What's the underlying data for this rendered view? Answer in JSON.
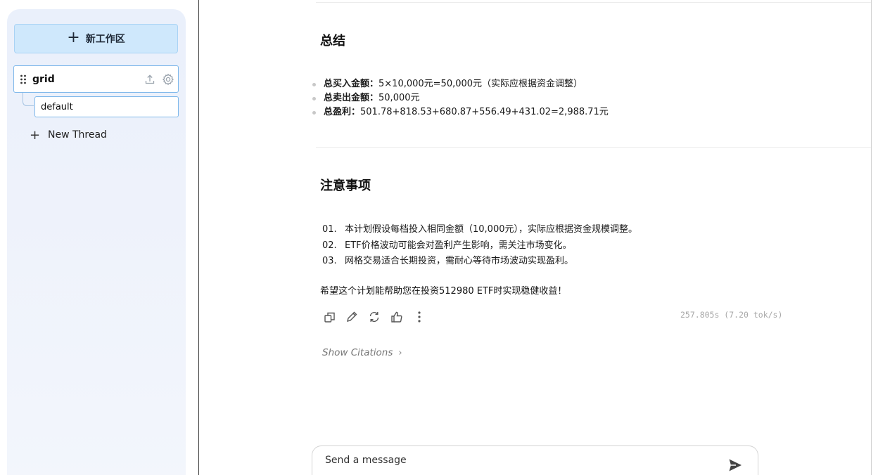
{
  "sidebar": {
    "new_workspace_label": "新工作区",
    "workspace": {
      "name": "grid",
      "thread": "default"
    },
    "new_thread_label": "New Thread"
  },
  "summary": {
    "title": "总结",
    "items": [
      {
        "label": "总买入金额：",
        "value": "5×10,000元=50,000元（实际应根据资金调整）"
      },
      {
        "label": "总卖出金额：",
        "value": "50,000元"
      },
      {
        "label": "总盈利：",
        "value": "501.78+818.53+680.87+556.49+431.02=2,988.71元"
      }
    ]
  },
  "notes": {
    "title": "注意事项",
    "items": [
      {
        "num": "01.",
        "text": "本计划假设每档投入相同金额（10,000元），实际应根据资金规模调整。"
      },
      {
        "num": "02.",
        "text": "ETF价格波动可能会对盈利产生影响，需关注市场变化。"
      },
      {
        "num": "03.",
        "text": "网格交易适合长期投资，需耐心等待市场波动实现盈利。"
      }
    ],
    "closing": "希望这个计划能帮助您在投资512980 ETF时实现稳健收益！"
  },
  "message": {
    "timing": "257.805s (7.20 tok/s)",
    "citations_label": "Show Citations",
    "actions": [
      "copy-icon",
      "edit-icon",
      "regenerate-icon",
      "thumbs-up-icon",
      "more-icon"
    ]
  },
  "composer": {
    "placeholder": "Send a message"
  },
  "colors": {
    "accent": "#cfe8fc",
    "accent_border": "#7fb8ea",
    "sidebar_bg": "#eaf0fb"
  }
}
